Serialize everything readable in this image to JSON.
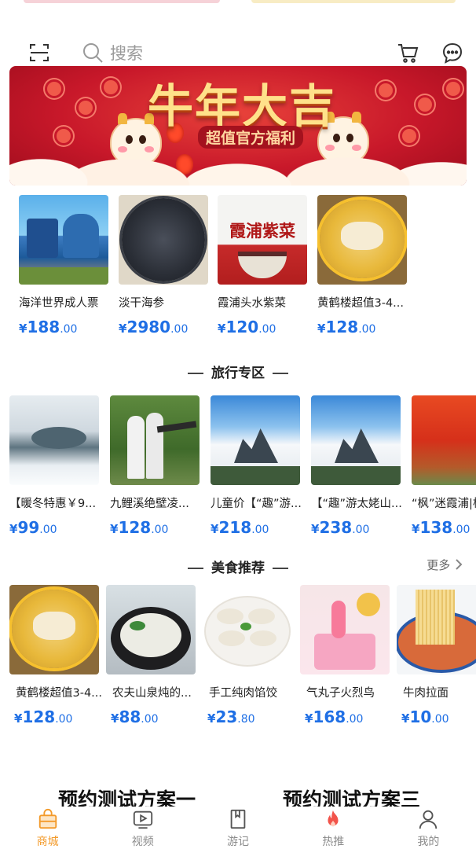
{
  "search": {
    "placeholder": "搜索"
  },
  "banner": {
    "title": "牛年大吉",
    "subtitle": "超值官方福利"
  },
  "featured": [
    {
      "name": "海洋世界成人票",
      "price_yen": "¥",
      "price_int": "188",
      "price_dec": ".00",
      "image": "ocean-park"
    },
    {
      "name": "淡干海参",
      "price_yen": "¥",
      "price_int": "2980",
      "price_dec": ".00",
      "image": "sea-cucumber"
    },
    {
      "name": "霞浦头水紫菜",
      "price_yen": "¥",
      "price_int": "120",
      "price_dec": ".00",
      "image": "seaweed",
      "image_text": "霞浦紫菜"
    },
    {
      "name": "黄鹤楼超值3-4...",
      "price_yen": "¥",
      "price_int": "128",
      "price_dec": ".00",
      "image": "fish-soup"
    }
  ],
  "travel": {
    "title": "旅行专区",
    "items": [
      {
        "name": "【暖冬特惠￥9...",
        "price_yen": "¥",
        "price_int": "99",
        "price_dec": ".00",
        "image": "snow-lake"
      },
      {
        "name": "九鲤溪绝壁凌...",
        "price_yen": "¥",
        "price_int": "128",
        "price_dec": ".00",
        "image": "people-outdoor"
      },
      {
        "name": "儿童价【“趣”游...",
        "price_yen": "¥",
        "price_int": "218",
        "price_dec": ".00",
        "image": "mountain-clouds"
      },
      {
        "name": "【“趣”游太姥山...",
        "price_yen": "¥",
        "price_int": "238",
        "price_dec": ".00",
        "image": "mountain-clouds"
      },
      {
        "name": "“枫”迷霞浦|杭",
        "price_yen": "¥",
        "price_int": "138",
        "price_dec": ".00",
        "image": "red-maple"
      }
    ]
  },
  "food": {
    "title": "美食推荐",
    "more_label": "更多",
    "items": [
      {
        "name": "黄鹤楼超值3-4...",
        "price_yen": "¥",
        "price_int": "128",
        "price_dec": ".00",
        "image": "fish-soup"
      },
      {
        "name": "农夫山泉炖的...",
        "price_yen": "¥",
        "price_int": "88",
        "price_dec": ".00",
        "image": "fish-stew"
      },
      {
        "name": "手工纯肉馅饺",
        "price_yen": "¥",
        "price_int": "23",
        "price_dec": ".80",
        "image": "dumplings"
      },
      {
        "name": "气丸子火烈鸟",
        "price_yen": "¥",
        "price_int": "168",
        "price_dec": ".00",
        "image": "flamingo-cake"
      },
      {
        "name": "牛肉拉面",
        "price_yen": "¥",
        "price_int": "10",
        "price_dec": ".00",
        "image": "beef-noodles"
      }
    ]
  },
  "promo_headings": [
    "预约测试方案一",
    "预约测试方案三"
  ],
  "tabbar": {
    "items": [
      {
        "label": "商城",
        "icon": "shop-bag-icon",
        "active": true
      },
      {
        "label": "视频",
        "icon": "video-icon",
        "active": false
      },
      {
        "label": "游记",
        "icon": "notebook-icon",
        "active": false
      },
      {
        "label": "热推",
        "icon": "flame-icon",
        "active": false
      },
      {
        "label": "我的",
        "icon": "user-icon",
        "active": false
      }
    ]
  },
  "colors": {
    "price": "#1f6fe5",
    "tab_active": "#f39a2a",
    "tab_inactive": "#8c8c8c",
    "banner_red": "#c8182a"
  }
}
